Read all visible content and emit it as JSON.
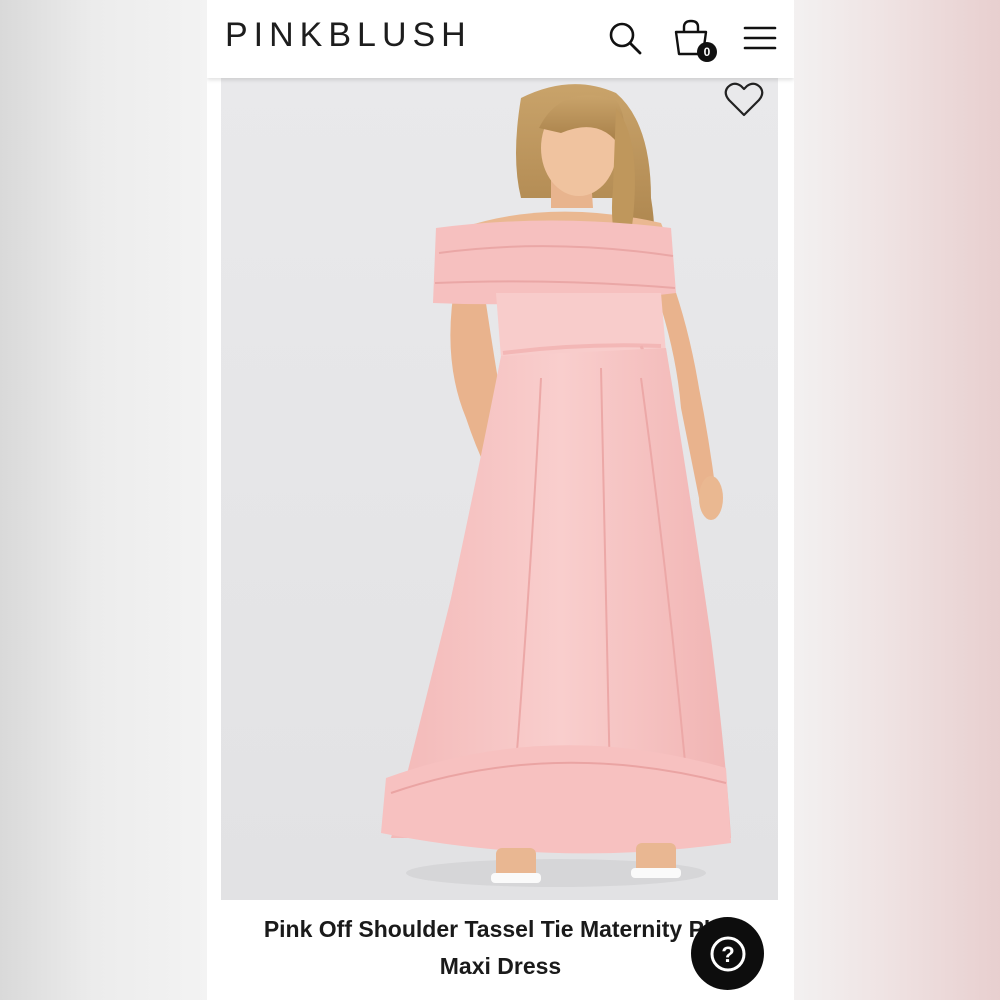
{
  "header": {
    "logo": "PINKBLUSH",
    "cart_count": "0",
    "icons": {
      "search": "search-icon",
      "cart": "shopping-bag-icon",
      "menu": "hamburger-menu-icon"
    }
  },
  "product": {
    "image_description_icon": "product-photo",
    "wishlist_icon": "heart-icon",
    "title": "Pink Off Shoulder Tassel Tie Maternity Plus Maxi Dress",
    "title_line1": "Pink Off Shoulder Tassel Tie Maternity Plus",
    "title_line2": "Maxi Dress"
  },
  "help": {
    "icon": "question-mark-icon",
    "label": "?"
  },
  "colors": {
    "dress_pink": "#f7c4c3",
    "photo_bg": "#e6e6e8",
    "help_button": "#0d0d0d"
  }
}
